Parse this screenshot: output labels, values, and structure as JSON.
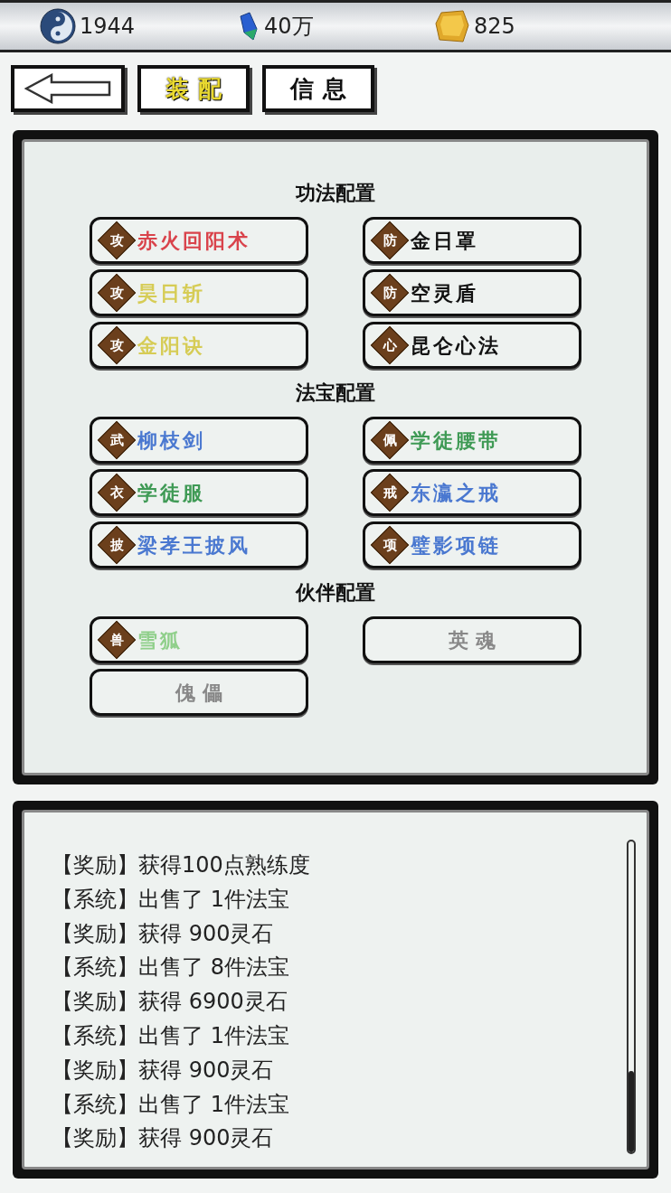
{
  "currencies": [
    {
      "kind": "taiji",
      "value": "1944"
    },
    {
      "kind": "crystal",
      "value": "40万"
    },
    {
      "kind": "gold",
      "value": "825"
    }
  ],
  "tabs": [
    {
      "label": "装 配",
      "selected": true
    },
    {
      "label": "信 息",
      "selected": false
    }
  ],
  "sections": [
    {
      "title": "功法配置",
      "slots": [
        {
          "kind": "item",
          "badge": "攻",
          "name": "赤火回阳术",
          "color": "#d9434b"
        },
        {
          "kind": "item",
          "badge": "防",
          "name": "金日罩",
          "color": "#111111"
        },
        {
          "kind": "item",
          "badge": "攻",
          "name": "昊日斩",
          "color": "#d6cc55"
        },
        {
          "kind": "item",
          "badge": "防",
          "name": "空灵盾",
          "color": "#111111"
        },
        {
          "kind": "item",
          "badge": "攻",
          "name": "金阳诀",
          "color": "#d6cc55"
        },
        {
          "kind": "item",
          "badge": "心",
          "name": "昆仑心法",
          "color": "#111111"
        }
      ]
    },
    {
      "title": "法宝配置",
      "slots": [
        {
          "kind": "item",
          "badge": "武",
          "name": "柳枝剑",
          "color": "#4a78d0"
        },
        {
          "kind": "item",
          "badge": "佩",
          "name": "学徒腰带",
          "color": "#3f9a55"
        },
        {
          "kind": "item",
          "badge": "衣",
          "name": "学徒服",
          "color": "#3f9a55"
        },
        {
          "kind": "item",
          "badge": "戒",
          "name": "东瀛之戒",
          "color": "#4a78d0"
        },
        {
          "kind": "item",
          "badge": "披",
          "name": "梁孝王披风",
          "color": "#4a78d0"
        },
        {
          "kind": "item",
          "badge": "项",
          "name": "璧影项链",
          "color": "#4a78d0"
        }
      ]
    },
    {
      "title": "伙伴配置",
      "slots": [
        {
          "kind": "item",
          "badge": "兽",
          "name": "雪狐",
          "color": "#8fcf8a"
        },
        {
          "kind": "empty",
          "name": "英 魂"
        },
        {
          "kind": "empty",
          "name": "傀 儡"
        }
      ]
    }
  ],
  "log": [
    "【奖励】获得100点熟练度",
    "【系统】出售了 1件法宝",
    "【奖励】获得 900灵石",
    "【系统】出售了 8件法宝",
    "【奖励】获得 6900灵石",
    "【系统】出售了 1件法宝",
    "【奖励】获得 900灵石",
    "【系统】出售了 1件法宝",
    "【奖励】获得 900灵石"
  ]
}
